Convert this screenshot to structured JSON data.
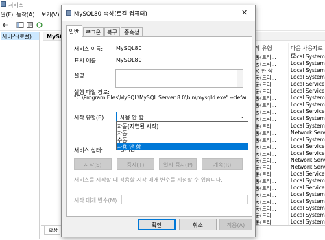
{
  "background": {
    "window_title": "서비스",
    "menu": [
      "일(F)",
      "동작(A)",
      "보기(V)"
    ],
    "tree_selected": "서비스(로컬)",
    "pane_header": "MySQ",
    "bottom_tab": "확장",
    "columns": {
      "status": "작 유형",
      "logon": "다음 사용자로 로"
    },
    "rows": [
      {
        "startup": "동(트리...",
        "logon": "Local System"
      },
      {
        "startup": "동(트리...",
        "logon": "Local System"
      },
      {
        "startup": "용 안 함",
        "logon": "Local System"
      },
      {
        "startup": "동(트리...",
        "logon": "Local System"
      },
      {
        "startup": "동(트리...",
        "logon": "Local Service"
      },
      {
        "startup": "동(트리...",
        "logon": "Local Service"
      },
      {
        "startup": "동(트리...",
        "logon": "Local System"
      },
      {
        "startup": "동(트리...",
        "logon": "Local System"
      },
      {
        "startup": "동(트리...",
        "logon": "Local Service"
      },
      {
        "startup": "동(트리...",
        "logon": "Local System"
      },
      {
        "startup": "동(트리...",
        "logon": "Local System"
      },
      {
        "startup": "동(트리...",
        "logon": "Network Service"
      },
      {
        "startup": "동(트리...",
        "logon": "Local System"
      },
      {
        "startup": "동(트리...",
        "logon": "Local Service"
      },
      {
        "startup": "동(트리...",
        "logon": "Local Service"
      },
      {
        "startup": "동(트리...",
        "logon": "Network Service"
      },
      {
        "startup": "동(트리...",
        "logon": "Network Service"
      },
      {
        "startup": "동(트리...",
        "logon": "Local Service"
      },
      {
        "startup": "동(트리...",
        "logon": "Local System"
      },
      {
        "startup": "동(트리...",
        "logon": "Local Service"
      },
      {
        "startup": "동(트리...",
        "logon": "Local System"
      },
      {
        "startup": "동(트리...",
        "logon": "Local System"
      },
      {
        "startup": "동(트리...",
        "logon": "Local System"
      },
      {
        "startup": "동(트리...",
        "logon": "Local System"
      },
      {
        "startup": "동(트리...",
        "logon": "Local System"
      },
      {
        "startup": "동(트리...",
        "logon": "Local System"
      },
      {
        "startup": "용 안 함",
        "logon": "Local System"
      }
    ]
  },
  "dialog": {
    "title": "MySQL80 속성(로컬 컴퓨터)",
    "close_glyph": "✕",
    "tabs": [
      "일반",
      "로그온",
      "복구",
      "종속성"
    ],
    "service_name_label": "서비스 이름:",
    "service_name": "MySQL80",
    "display_name_label": "표시 이름:",
    "display_name": "MySQL80",
    "description_label": "설명:",
    "path_label": "실행 파일 경로:",
    "path": "\"C:\\Program Files\\MySQL\\MySQL Server 8.0\\bin\\mysqld.exe\" --defaults-f",
    "startup_type_label": "시작 유형(E):",
    "startup_type_value": "사용 안 함",
    "startup_options": [
      "자동(지연된 시작)",
      "자동",
      "수동",
      "사용 안 함"
    ],
    "status_label": "서비스 상태:",
    "status_value": "중지됨",
    "start_button": "시작(S)",
    "stop_button": "중지(T)",
    "pause_button": "일시 중지(P)",
    "resume_button": "계속(R)",
    "help_text": "서비스를 시작할 때 적용할 시작 매개 변수를 지정할 수 있습니다.",
    "param_label": "시작 매개 변수(M):",
    "ok_button": "확인",
    "cancel_button": "취소",
    "apply_button": "적용(A)"
  }
}
